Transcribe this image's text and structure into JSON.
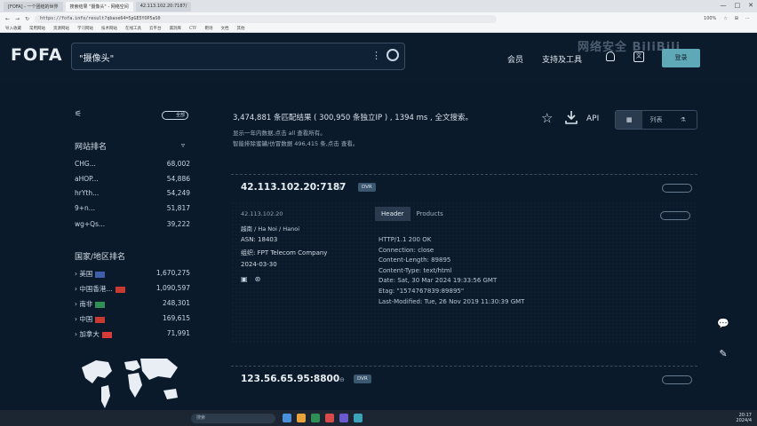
{
  "browser": {
    "tabs": [
      "[FOFA] - 一个团结的世界",
      "搜索结果 \"摄像头\" - 网络空间",
      "42.113.102.20:7187/"
    ],
    "url": "https://fofa.info/result?qbase64=5pGE5YOP5aS0",
    "zoom": "100%",
    "bookmarks": [
      "导入收藏",
      "常用网站",
      "资源网站",
      "学习网站",
      "技术网站",
      "在线工具",
      "云平台",
      "漏洞库",
      "CTF",
      "靶场",
      "文档",
      "其他"
    ]
  },
  "appbar": {
    "logo": "FOFA",
    "query": "\"摄像头\"",
    "nav_member": "会员",
    "nav_support": "支持及工具",
    "login_label": "登录",
    "watermark": "网络安全 BiliBili"
  },
  "sidebar": {
    "toggle_label": "全部",
    "site_rank_title": "网站排名",
    "sites": [
      {
        "name": "CHG...",
        "count": "68,002"
      },
      {
        "name": "aHOP...",
        "count": "54,886"
      },
      {
        "name": "hrYth...",
        "count": "54,249"
      },
      {
        "name": "9+n...",
        "count": "51,817"
      },
      {
        "name": "wg+Qs...",
        "count": "39,222"
      }
    ],
    "country_rank_title": "国家/地区排名",
    "countries": [
      {
        "name": "美国",
        "count": "1,670,275",
        "flag_color": "#3c5fa8"
      },
      {
        "name": "中国香港...",
        "count": "1,090,597",
        "flag_color": "#c8392f"
      },
      {
        "name": "南非",
        "count": "248,301",
        "flag_color": "#2f8f55"
      },
      {
        "name": "中国",
        "count": "169,615",
        "flag_color": "#c8392f"
      },
      {
        "name": "加拿大",
        "count": "71,991",
        "flag_color": "#d93a3a"
      }
    ]
  },
  "results": {
    "summary": "3,474,881 条匹配结果 ( 300,950 条独立IP ) , 1394 ms , 全文搜索。",
    "hint1": "显示一年内数据,点击 all 查看所有。",
    "hint2": "智能排除蜜罐/仿冒数据 496,415 条,点击 查看。",
    "api_label": "API",
    "view_modes": [
      "",
      "列表",
      ""
    ],
    "cards": [
      {
        "title": "42.113.102.20:7187",
        "tag": "DVR",
        "ip": "42.113.102.20",
        "location": "越南 / Ha Noi / Hanoi",
        "asn": "ASN: 18403",
        "org": "组织: FPT Telecom Company",
        "date": "2024-03-30",
        "tab_header": "Header",
        "tab_products": "Products",
        "headers": [
          "HTTP/1.1 200 OK",
          "Connection: close",
          "Content-Length: 89895",
          "Content-Type: text/html",
          "Date: Sat, 30 Mar 2024 19:33:56 GMT",
          "Etag: \"1574767839:89895\"",
          "Last-Modified: Tue, 26 Nov 2019 11:30:39 GMT"
        ]
      },
      {
        "title": "123.56.65.95:8800",
        "tag": "DVR"
      }
    ]
  },
  "taskbar": {
    "search_placeholder": "搜索",
    "time": "20:17",
    "date": "2024/4"
  }
}
